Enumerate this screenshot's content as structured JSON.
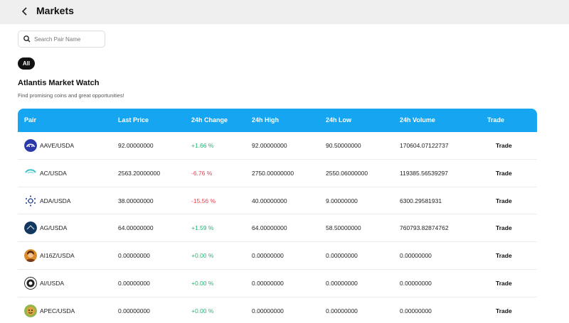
{
  "header": {
    "title": "Markets",
    "back_icon": "chevron-left-icon"
  },
  "search": {
    "placeholder": "Search Pair Name",
    "value": ""
  },
  "filters": {
    "all_label": "All"
  },
  "section": {
    "title": "Atlantis Market Watch",
    "subtitle": "Find promising coins and great opportunities!"
  },
  "table": {
    "accent": "#16a6f1",
    "columns": [
      "Pair",
      "Last Price",
      "24h Change",
      "24h High",
      "24h Low",
      "24h Volume",
      "Trade"
    ],
    "rows": [
      {
        "pair": "AAVE/USDA",
        "price": "92.00000000",
        "change": "+1.66 %",
        "dir": "pos",
        "high": "92.00000000",
        "low": "90.50000000",
        "volume": "170604.07122737",
        "trade": "Trade",
        "icon": "aave-logo-icon"
      },
      {
        "pair": "AC/USDA",
        "price": "2563.20000000",
        "change": "-6.76 %",
        "dir": "neg",
        "high": "2750.00000000",
        "low": "2550.06000000",
        "volume": "119385.56539297",
        "trade": "Trade",
        "icon": "ac-logo-icon"
      },
      {
        "pair": "ADA/USDA",
        "price": "38.00000000",
        "change": "-15.56 %",
        "dir": "neg",
        "high": "40.00000000",
        "low": "9.00000000",
        "volume": "6300.29581931",
        "trade": "Trade",
        "icon": "cardano-logo-icon"
      },
      {
        "pair": "AG/USDA",
        "price": "64.00000000",
        "change": "+1.59 %",
        "dir": "pos",
        "high": "64.00000000",
        "low": "58.50000000",
        "volume": "760793.82874762",
        "trade": "Trade",
        "icon": "ag-logo-icon"
      },
      {
        "pair": "AI16Z/USDA",
        "price": "0.00000000",
        "change": "+0.00 %",
        "dir": "pos",
        "high": "0.00000000",
        "low": "0.00000000",
        "volume": "0.00000000",
        "trade": "Trade",
        "icon": "ai16z-avatar-icon"
      },
      {
        "pair": "AI/USDA",
        "price": "0.00000000",
        "change": "+0.00 %",
        "dir": "pos",
        "high": "0.00000000",
        "low": "0.00000000",
        "volume": "0.00000000",
        "trade": "Trade",
        "icon": "ai-logo-icon"
      },
      {
        "pair": "APEC/USDA",
        "price": "0.00000000",
        "change": "+0.00 %",
        "dir": "pos",
        "high": "0.00000000",
        "low": "0.00000000",
        "volume": "0.00000000",
        "trade": "Trade",
        "icon": "apec-logo-icon"
      }
    ]
  }
}
